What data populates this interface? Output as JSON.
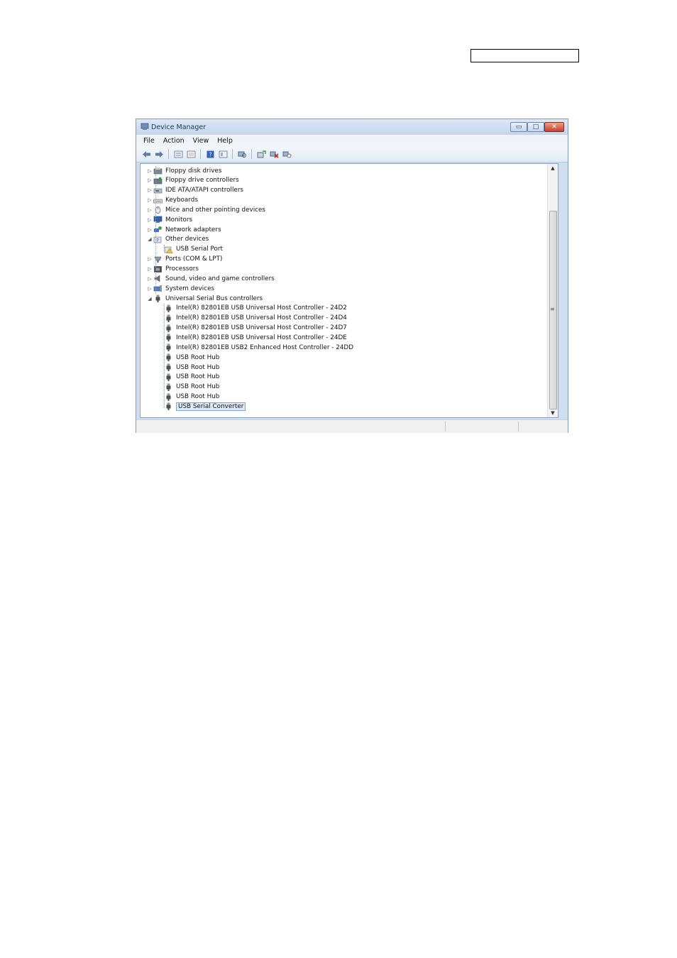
{
  "window": {
    "title": "Device Manager",
    "buttons": {
      "minimize": "▭",
      "maximize": "□",
      "close": "✕"
    }
  },
  "menu": [
    "File",
    "Action",
    "View",
    "Help"
  ],
  "toolbar": [
    "back-arrow-icon",
    "forward-arrow-icon",
    "properties-icon",
    "details-icon",
    "help-icon",
    "view-icon",
    "scan-hardware-icon",
    "update-driver-icon",
    "uninstall-icon",
    "disable-icon"
  ],
  "tree": [
    {
      "label": "Floppy disk drives",
      "level": 0,
      "expand": "▷",
      "icon": "floppy-disk-icon"
    },
    {
      "label": "Floppy drive controllers",
      "level": 0,
      "expand": "▷",
      "icon": "floppy-controller-icon"
    },
    {
      "label": "IDE ATA/ATAPI controllers",
      "level": 0,
      "expand": "▷",
      "icon": "ide-controller-icon"
    },
    {
      "label": "Keyboards",
      "level": 0,
      "expand": "▷",
      "icon": "keyboard-icon"
    },
    {
      "label": "Mice and other pointing devices",
      "level": 0,
      "expand": "▷",
      "icon": "mouse-icon"
    },
    {
      "label": "Monitors",
      "level": 0,
      "expand": "▷",
      "icon": "monitor-icon"
    },
    {
      "label": "Network adapters",
      "level": 0,
      "expand": "▷",
      "icon": "network-adapter-icon"
    },
    {
      "label": "Other devices",
      "level": 0,
      "expand": "◢",
      "icon": "other-devices-icon"
    },
    {
      "label": "USB Serial Port",
      "level": 1,
      "expand": "",
      "icon": "warning-device-icon"
    },
    {
      "label": "Ports (COM & LPT)",
      "level": 0,
      "expand": "▷",
      "icon": "port-icon"
    },
    {
      "label": "Processors",
      "level": 0,
      "expand": "▷",
      "icon": "processor-icon"
    },
    {
      "label": "Sound, video and game controllers",
      "level": 0,
      "expand": "▷",
      "icon": "speaker-icon"
    },
    {
      "label": "System devices",
      "level": 0,
      "expand": "▷",
      "icon": "system-devices-icon"
    },
    {
      "label": "Universal Serial Bus controllers",
      "level": 0,
      "expand": "◢",
      "icon": "usb-icon"
    },
    {
      "label": "Intel(R) 82801EB USB Universal Host Controller - 24D2",
      "level": 1,
      "expand": "",
      "icon": "usb-icon"
    },
    {
      "label": "Intel(R) 82801EB USB Universal Host Controller - 24D4",
      "level": 1,
      "expand": "",
      "icon": "usb-icon"
    },
    {
      "label": "Intel(R) 82801EB USB Universal Host Controller - 24D7",
      "level": 1,
      "expand": "",
      "icon": "usb-icon"
    },
    {
      "label": "Intel(R) 82801EB USB Universal Host Controller - 24DE",
      "level": 1,
      "expand": "",
      "icon": "usb-icon"
    },
    {
      "label": "Intel(R) 82801EB USB2 Enhanced Host Controller - 24DD",
      "level": 1,
      "expand": "",
      "icon": "usb-icon"
    },
    {
      "label": "USB Root Hub",
      "level": 1,
      "expand": "",
      "icon": "usb-icon"
    },
    {
      "label": "USB Root Hub",
      "level": 1,
      "expand": "",
      "icon": "usb-icon"
    },
    {
      "label": "USB Root Hub",
      "level": 1,
      "expand": "",
      "icon": "usb-icon"
    },
    {
      "label": "USB Root Hub",
      "level": 1,
      "expand": "",
      "icon": "usb-icon"
    },
    {
      "label": "USB Root Hub",
      "level": 1,
      "expand": "",
      "icon": "usb-icon"
    },
    {
      "label": "USB Serial Converter",
      "level": 1,
      "expand": "",
      "icon": "usb-icon",
      "selected": true
    }
  ],
  "scrollbar": {
    "up": "▲",
    "down": "▼",
    "grip": "≡"
  }
}
